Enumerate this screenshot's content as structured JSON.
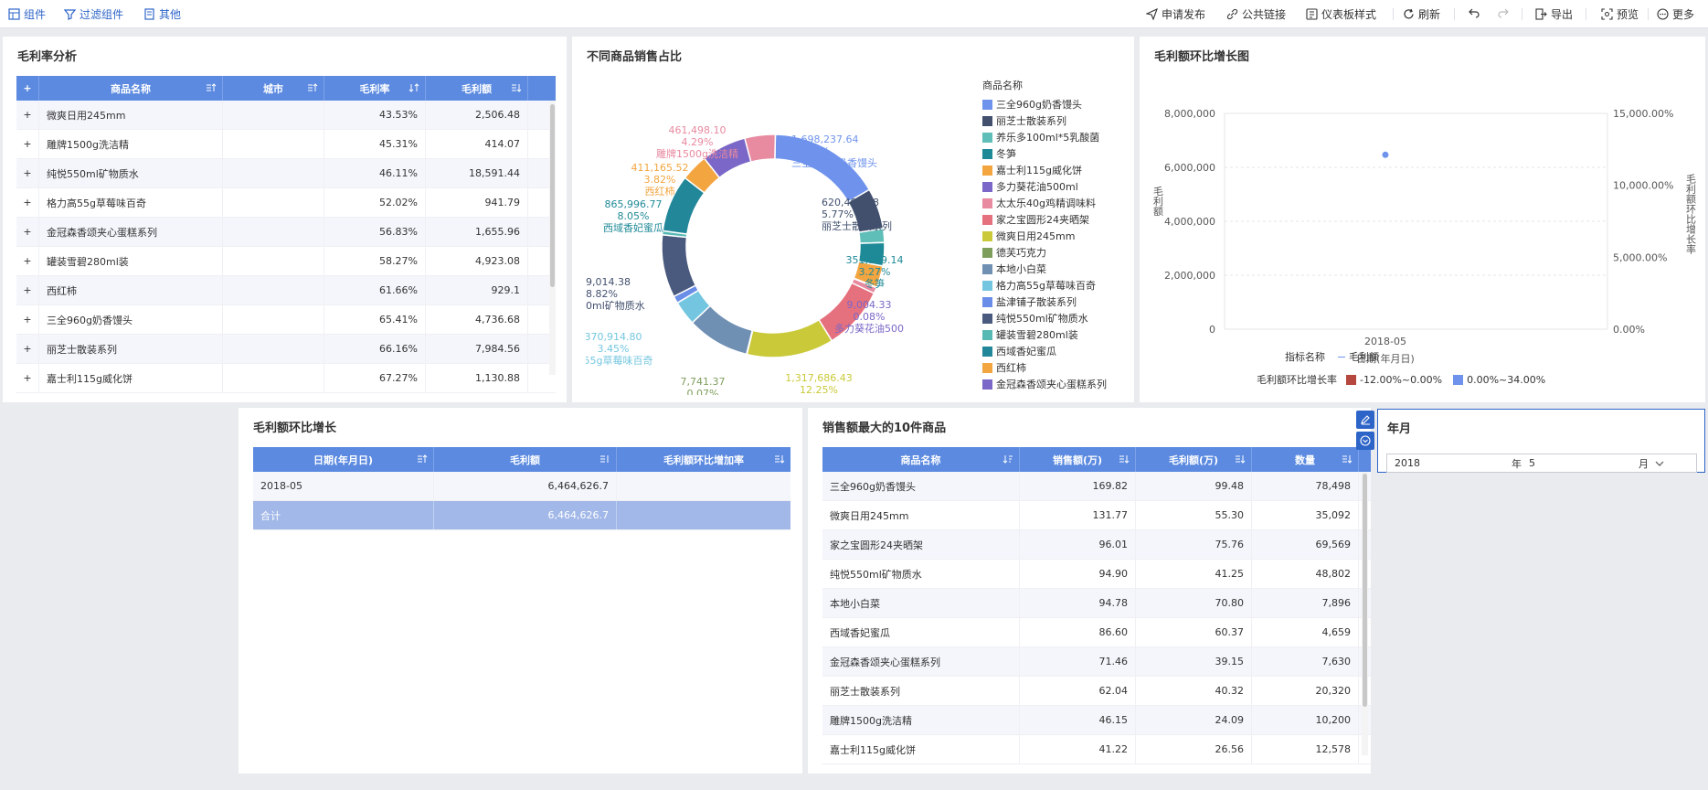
{
  "toolbar": {
    "left": [
      "组件",
      "过滤组件",
      "其他"
    ],
    "right": [
      "申请发布",
      "公共链接",
      "仪表板样式",
      "刷新",
      "导出",
      "预览",
      "更多"
    ]
  },
  "panel_margin": {
    "title": "毛利率分析",
    "columns": [
      "商品名称",
      "城市",
      "毛利率",
      "毛利额"
    ],
    "rows": [
      [
        "微爽日用245mm",
        "",
        "43.53%",
        "2,506.48"
      ],
      [
        "雕牌1500g洗洁精",
        "",
        "45.31%",
        "414.07"
      ],
      [
        "纯悦550ml矿物质水",
        "",
        "46.11%",
        "18,591.44"
      ],
      [
        "格力高55g草莓味百奇",
        "",
        "52.02%",
        "941.79"
      ],
      [
        "金冠森香颂夹心蛋糕系列",
        "",
        "56.83%",
        "1,655.96"
      ],
      [
        "罐装雪碧280ml装",
        "",
        "58.27%",
        "4,923.08"
      ],
      [
        "西红柿",
        "",
        "61.66%",
        "929.1"
      ],
      [
        "三全960g奶香馒头",
        "",
        "65.41%",
        "4,736.68"
      ],
      [
        "丽芝士散装系列",
        "",
        "66.16%",
        "7,984.56"
      ],
      [
        "嘉士利115g威化饼",
        "",
        "67.27%",
        "1,130.88"
      ]
    ]
  },
  "panel_pie": {
    "title": "不同商品销售占比",
    "legend_title": "商品名称",
    "legend": [
      {
        "name": "三全960g奶香馒头",
        "color": "#6f93ec"
      },
      {
        "name": "丽芝士散装系列",
        "color": "#42506e"
      },
      {
        "name": "养乐多100ml*5乳酸菌",
        "color": "#5fbeb8"
      },
      {
        "name": "冬笋",
        "color": "#1f8a97"
      },
      {
        "name": "嘉士利115g威化饼",
        "color": "#f3a540"
      },
      {
        "name": "多力葵花油500ml",
        "color": "#7a67c7"
      },
      {
        "name": "太太乐40g鸡精调味料",
        "color": "#e88aa0"
      },
      {
        "name": "家之宝圆形24夹晒架",
        "color": "#e5707e"
      },
      {
        "name": "微爽日用245mm",
        "color": "#c9c93a"
      },
      {
        "name": "德芙巧克力",
        "color": "#7e9e5c"
      },
      {
        "name": "本地小白菜",
        "color": "#6f8fb3"
      },
      {
        "name": "格力高55g草莓味百奇",
        "color": "#74c6e0"
      },
      {
        "name": "盐津铺子散装系列",
        "color": "#6a8ee8"
      },
      {
        "name": "纯悦550ml矿物质水",
        "color": "#4a5a7e"
      },
      {
        "name": "罐装雪碧280ml装",
        "color": "#58b9b4"
      },
      {
        "name": "西域香妃蜜瓜",
        "color": "#23879a"
      },
      {
        "name": "西红柿",
        "color": "#f3a540"
      },
      {
        "name": "金冠森香颂夹心蛋糕系列",
        "color": "#7a67c7"
      }
    ]
  },
  "chart_data": [
    {
      "type": "pie",
      "title": "不同商品销售占比",
      "legend_title": "商品名称",
      "slices": [
        {
          "name": "三全960g奶香馒头",
          "value": 1698237.64,
          "percent": 15.79,
          "value_label": "1,698,237.64",
          "percent_label": "15.79%",
          "color": "#6f93ec"
        },
        {
          "name": "丽芝士散装系列",
          "value": 620408.58,
          "percent": 5.77,
          "value_label": "620,408.58",
          "percent_label": "5.77%",
          "color": "#42506e"
        },
        {
          "name": "养乐多100ml*5乳酸菌",
          "value": 210000,
          "percent": 1.95,
          "color": "#5fbeb8"
        },
        {
          "name": "冬笋",
          "value": 351979.14,
          "percent": 3.27,
          "value_label": "351,979.14",
          "percent_label": "3.27%",
          "color": "#1f8a97"
        },
        {
          "name": "嘉士利115g威化饼",
          "value": 330000,
          "percent": 3.07,
          "color": "#f3a540"
        },
        {
          "name": "多力葵花油500ml",
          "value": 9004.33,
          "percent": 0.08,
          "value_label": "9,004.33",
          "percent_label": "0.08%",
          "color": "#7a67c7"
        },
        {
          "name": "太太乐40g鸡精调味料",
          "value": 90000,
          "percent": 0.84,
          "color": "#e88aa0"
        },
        {
          "name": "家之宝圆形24夹晒架",
          "value": 960000,
          "percent": 8.93,
          "color": "#e5707e"
        },
        {
          "name": "微爽日用245mm",
          "value": 1317686.43,
          "percent": 12.25,
          "value_label": "1,317,686.43",
          "percent_label": "12.25%",
          "color": "#c9c93a"
        },
        {
          "name": "德芙巧克力",
          "value": 7741.37,
          "percent": 0.07,
          "value_label": "7,741.37",
          "percent_label": "0.07%",
          "color": "#7e9e5c"
        },
        {
          "name": "本地小白菜",
          "value": 947800,
          "percent": 8.81,
          "color": "#6f8fb3"
        },
        {
          "name": "格力高55g草莓味百奇",
          "value": 370914.8,
          "percent": 3.45,
          "value_label": "370,914.80",
          "percent_label": "3.45%",
          "color": "#74c6e0"
        },
        {
          "name": "盐津铺子散装系列",
          "value": 110000,
          "percent": 1.02,
          "color": "#6a8ee8"
        },
        {
          "name": "纯悦550ml矿物质水",
          "value": 949014.38,
          "percent": 8.82,
          "value_label": "9,014.38",
          "percent_label": "8.82%",
          "color": "#4a5a7e"
        },
        {
          "name": "罐装雪碧280ml装",
          "value": 60000,
          "percent": 0.56,
          "color": "#58b9b4"
        },
        {
          "name": "西域香妃蜜瓜",
          "value": 865996.77,
          "percent": 8.05,
          "value_label": "865,996.77",
          "percent_label": "8.05%",
          "color": "#23879a"
        },
        {
          "name": "西红柿",
          "value": 411165.52,
          "percent": 3.82,
          "value_label": "411,165.52",
          "percent_label": "3.82%",
          "color": "#f3a540"
        },
        {
          "name": "金冠森香颂夹心蛋糕系列",
          "value": 680000,
          "percent": 6.32,
          "color": "#7a67c7"
        },
        {
          "name": "雕牌1500g洗洁精",
          "value": 461498.1,
          "percent": 4.29,
          "value_label": "461,498.10",
          "percent_label": "4.29%",
          "color": "#e88aa0"
        }
      ],
      "outer_labels": [
        {
          "value": "1,698,237.64",
          "percent": "15.79%",
          "name": "三全960g奶香馒头",
          "color": "#6f93ec"
        },
        {
          "value": "620,408.58",
          "percent": "5.77%",
          "name": "丽芝士散装系列",
          "color": "#42506e"
        },
        {
          "value": "351,979.14",
          "percent": "3.27%",
          "name": "冬笋",
          "color": "#1f8a97"
        },
        {
          "value": "9,004.33",
          "percent": "0.08%",
          "name": "多力葵花油500",
          "color": "#7a67c7"
        },
        {
          "value": "1,317,686.43",
          "percent": "12.25%",
          "name": "微爽日用245mm",
          "color": "#c9c93a"
        },
        {
          "value": "7,741.37",
          "percent": "0.07%",
          "name": "德芙巧克力",
          "color": "#7e9e5c"
        },
        {
          "value": "370,914.80",
          "percent": "3.45%",
          "name": "高55g草莓味百奇",
          "color": "#74c6e0"
        },
        {
          "value": "9,014.38",
          "percent": "8.82%",
          "name": "0ml矿物质水",
          "color": "#42506e"
        },
        {
          "value": "865,996.77",
          "percent": "8.05%",
          "name": "西域香妃蜜瓜",
          "color": "#1f8a97"
        },
        {
          "value": "411,165.52",
          "percent": "3.82%",
          "name": "西红柿",
          "color": "#f3a540"
        },
        {
          "value": "461,498.10",
          "percent": "4.29%",
          "name": "雕牌1500g洗洁精",
          "color": "#e88aa0"
        }
      ]
    },
    {
      "type": "scatter",
      "title": "毛利额环比增长图",
      "x": [
        "2018-05"
      ],
      "y": [
        6464626.7
      ],
      "xlabel": "日期(年月日)",
      "ylabel": "毛利额",
      "y2label": "毛利额环比增长率",
      "ylim": [
        0,
        8000000
      ],
      "y_ticks": [
        "0",
        "2,000,000",
        "4,000,000",
        "6,000,000",
        "8,000,000"
      ],
      "y2lim": [
        0,
        15000
      ],
      "y2_ticks": [
        "0.00%",
        "5,000.00%",
        "10,000.00%",
        "15,000.00%"
      ],
      "point_color": "#6f93ec",
      "legend": {
        "metric_label": "指标名称",
        "metric_name": "毛利额",
        "rate_label": "毛利额环比增长率",
        "ranges": [
          {
            "label": "-12.00%~0.00%",
            "color": "#b5473f"
          },
          {
            "label": "0.00%~34.00%",
            "color": "#6f93ec"
          }
        ]
      }
    }
  ],
  "panel_growth": {
    "title": "毛利额环比增长",
    "columns": [
      "日期(年月日)",
      "毛利额",
      "毛利额环比增加率"
    ],
    "rows": [
      [
        "2018-05",
        "6,464,626.7",
        ""
      ]
    ],
    "total": [
      "合计",
      "6,464,626.7",
      ""
    ]
  },
  "panel_top10": {
    "title": "销售额最大的10件商品",
    "columns": [
      "商品名称",
      "销售额(万)",
      "毛利额(万)",
      "数量"
    ],
    "rows": [
      [
        "三全960g奶香馒头",
        "169.82",
        "99.48",
        "78,498"
      ],
      [
        "微爽日用245mm",
        "131.77",
        "55.30",
        "35,092"
      ],
      [
        "家之宝圆形24夹晒架",
        "96.01",
        "75.76",
        "69,569"
      ],
      [
        "纯悦550ml矿物质水",
        "94.90",
        "41.25",
        "48,802"
      ],
      [
        "本地小白菜",
        "94.78",
        "70.80",
        "7,896"
      ],
      [
        "西域香妃蜜瓜",
        "86.60",
        "60.37",
        "4,659"
      ],
      [
        "金冠森香颂夹心蛋糕系列",
        "71.46",
        "39.15",
        "7,630"
      ],
      [
        "丽芝士散装系列",
        "62.04",
        "40.32",
        "20,320"
      ],
      [
        "雕牌1500g洗洁精",
        "46.15",
        "24.09",
        "10,200"
      ],
      [
        "嘉士利115g威化饼",
        "41.22",
        "26.56",
        "12,578"
      ]
    ]
  },
  "panel_filter": {
    "title": "年月",
    "year": "2018",
    "year_unit": "年",
    "month": "5",
    "month_unit": "月"
  }
}
